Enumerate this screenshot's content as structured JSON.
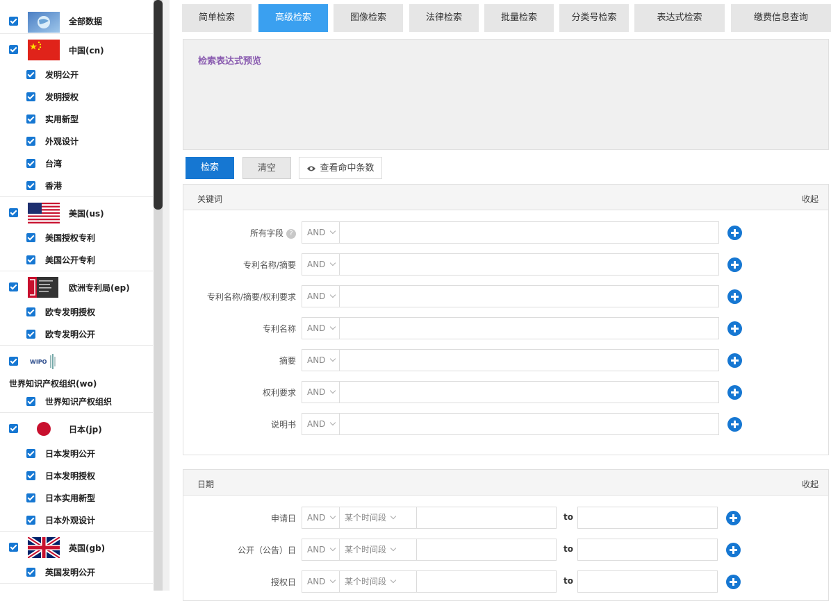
{
  "sidebar": {
    "groups": [
      {
        "label": "全部数据",
        "flag": "globe-icon",
        "children": []
      },
      {
        "label": "中国(cn)",
        "flag": "china-flag-icon",
        "children": [
          "发明公开",
          "发明授权",
          "实用新型",
          "外观设计",
          "台湾",
          "香港"
        ]
      },
      {
        "label": "美国(us)",
        "flag": "usa-flag-icon",
        "children": [
          "美国授权专利",
          "美国公开专利"
        ]
      },
      {
        "label": "欧洲专利局(ep)",
        "flag": "epo-logo-icon",
        "children": [
          "欧专发明授权",
          "欧专发明公开"
        ]
      },
      {
        "label": "世界知识产权组织(wo)",
        "flag": "wipo-logo-icon",
        "logo_text": "WIPO",
        "children": [
          "世界知识产权组织"
        ]
      },
      {
        "label": "日本(jp)",
        "flag": "japan-flag-icon",
        "children": [
          "日本发明公开",
          "日本发明授权",
          "日本实用新型",
          "日本外观设计"
        ]
      },
      {
        "label": "英国(gb)",
        "flag": "uk-flag-icon",
        "children": [
          "英国发明公开"
        ]
      }
    ]
  },
  "tabs": [
    {
      "label": "简单检索",
      "active": false
    },
    {
      "label": "高级检索",
      "active": true
    },
    {
      "label": "图像检索",
      "active": false
    },
    {
      "label": "法律检索",
      "active": false
    },
    {
      "label": "批量检索",
      "active": false
    },
    {
      "label": "分类号检索",
      "active": false
    },
    {
      "label": "表达式检索",
      "active": false
    },
    {
      "label": "缴费信息查询",
      "active": false
    }
  ],
  "preview": {
    "title": "检索表达式预览"
  },
  "actions": {
    "search": "检索",
    "clear": "清空",
    "view_hits": "查看命中条数"
  },
  "keywords": {
    "title": "关键词",
    "collapse": "收起",
    "rows": [
      {
        "label": "所有字段",
        "op": "AND",
        "help": "?"
      },
      {
        "label": "专利名称/摘要",
        "op": "AND"
      },
      {
        "label": "专利名称/摘要/权利要求",
        "op": "AND"
      },
      {
        "label": "专利名称",
        "op": "AND"
      },
      {
        "label": "摘要",
        "op": "AND"
      },
      {
        "label": "权利要求",
        "op": "AND"
      },
      {
        "label": "说明书",
        "op": "AND"
      }
    ]
  },
  "dates": {
    "title": "日期",
    "collapse": "收起",
    "rows": [
      {
        "label": "申请日",
        "op": "AND",
        "range": "某个时间段",
        "to": "to"
      },
      {
        "label": "公开（公告）日",
        "op": "AND",
        "range": "某个时间段",
        "to": "to"
      },
      {
        "label": "授权日",
        "op": "AND",
        "range": "某个时间段",
        "to": "to"
      }
    ]
  },
  "colors": {
    "accent": "#1677d2",
    "tab_active": "#3aa0f0",
    "preview_title": "#8a5cb0"
  }
}
